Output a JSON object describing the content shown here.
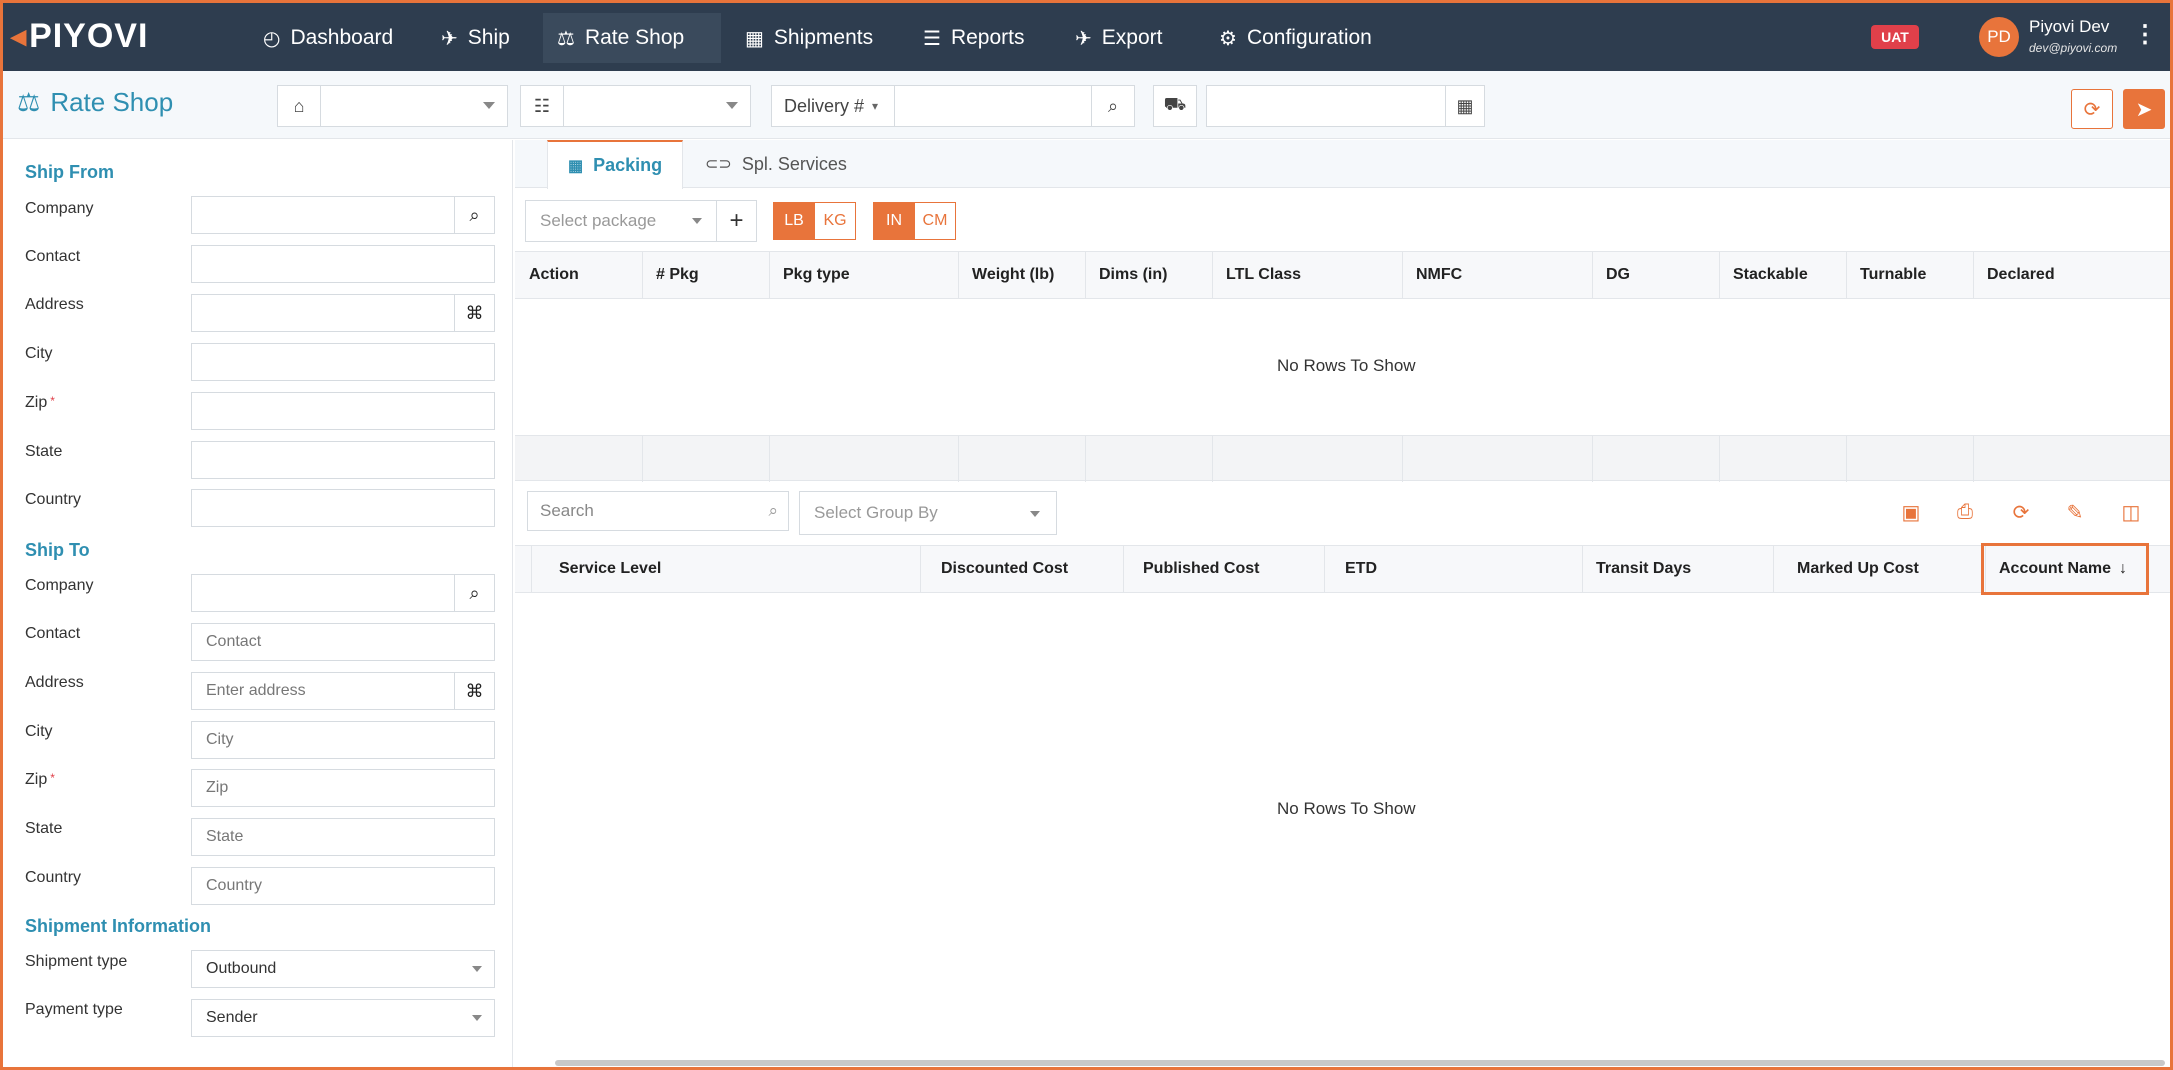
{
  "brand": {
    "logo": "PIYOVI"
  },
  "nav": {
    "items": [
      {
        "label": "Dashboard",
        "icon": "dashboard-icon"
      },
      {
        "label": "Ship",
        "icon": "plane-icon"
      },
      {
        "label": "Rate Shop",
        "icon": "balance-scale-icon",
        "active": true
      },
      {
        "label": "Shipments",
        "icon": "boxes-icon"
      },
      {
        "label": "Reports",
        "icon": "report-icon"
      },
      {
        "label": "Export",
        "icon": "export-plane-icon"
      },
      {
        "label": "Configuration",
        "icon": "gear-icon"
      }
    ],
    "env_badge": "UAT",
    "user": {
      "initials": "PD",
      "name": "Piyovi Dev",
      "email": "dev@piyovi.com"
    }
  },
  "toolbar": {
    "title": "Rate Shop",
    "delivery_label": "Delivery #",
    "warehouse_value": "",
    "location_value": "",
    "delivery_value": "",
    "date_value": ""
  },
  "left": {
    "ship_from": {
      "title": "Ship From",
      "fields": [
        {
          "label": "Company",
          "value": ""
        },
        {
          "label": "Contact",
          "value": ""
        },
        {
          "label": "Address",
          "value": ""
        },
        {
          "label": "City",
          "value": ""
        },
        {
          "label": "Zip",
          "value": "",
          "required": true
        },
        {
          "label": "State",
          "value": ""
        },
        {
          "label": "Country",
          "value": ""
        }
      ]
    },
    "ship_to": {
      "title": "Ship To",
      "fields": [
        {
          "label": "Company",
          "placeholder": ""
        },
        {
          "label": "Contact",
          "placeholder": "Contact"
        },
        {
          "label": "Address",
          "placeholder": "Enter address"
        },
        {
          "label": "City",
          "placeholder": "City"
        },
        {
          "label": "Zip",
          "placeholder": "Zip",
          "required": true
        },
        {
          "label": "State",
          "placeholder": "State"
        },
        {
          "label": "Country",
          "placeholder": "Country"
        }
      ]
    },
    "shipment_info": {
      "title": "Shipment Information",
      "shipment_type_label": "Shipment type",
      "shipment_type_value": "Outbound",
      "payment_type_label": "Payment type",
      "payment_type_value": "Sender"
    }
  },
  "tabs": [
    {
      "label": "Packing",
      "icon": "packing-icon",
      "active": true
    },
    {
      "label": "Spl. Services",
      "icon": "toggle-icon",
      "active": false
    }
  ],
  "packing": {
    "select_placeholder": "Select package",
    "weight_units": [
      "LB",
      "KG"
    ],
    "dim_units": [
      "IN",
      "CM"
    ],
    "columns": [
      "Action",
      "# Pkg",
      "Pkg type",
      "Weight (lb)",
      "Dims (in)",
      "LTL Class",
      "NMFC",
      "DG",
      "Stackable",
      "Turnable",
      "Declared"
    ],
    "empty_text": "No Rows To Show"
  },
  "rates": {
    "search_placeholder": "Search",
    "groupby_placeholder": "Select Group By",
    "columns": [
      "Service Level",
      "Discounted Cost",
      "Published Cost",
      "ETD",
      "Transit Days",
      "Marked Up Cost",
      "Account Name"
    ],
    "sort_indicator": "↓",
    "empty_text": "No Rows To Show"
  },
  "colors": {
    "accent": "#e8743b",
    "nav_bg": "#2e3d4f",
    "title_blue": "#2f8fb1"
  }
}
